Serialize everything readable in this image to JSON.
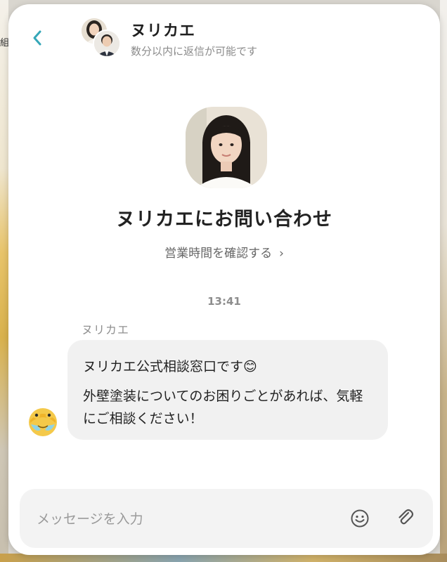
{
  "background": {
    "top_left_glyph": "組"
  },
  "header": {
    "back_icon": "chevron-left-icon",
    "title": "ヌリカエ",
    "subtitle": "数分以内に返信が可能です"
  },
  "hero": {
    "title": "ヌリカエにお問い合わせ",
    "hours_link": "営業時間を確認する",
    "hours_chevron": "›"
  },
  "conversation": {
    "timestamp": "13:41",
    "sender_name": "ヌリカエ",
    "message_line1": "ヌリカエ公式相談窓口です",
    "message_emoji": "😊",
    "message_line2": "外壁塗装についてのお困りごとがあれば、気軽にご相談ください！"
  },
  "composer": {
    "placeholder": "メッセージを入力",
    "value": "",
    "emoji_icon": "smiley-icon",
    "attach_icon": "paperclip-icon"
  },
  "colors": {
    "accent": "#35a7b8",
    "bubble": "#f1f1f1",
    "composer": "#f3f3f3"
  }
}
